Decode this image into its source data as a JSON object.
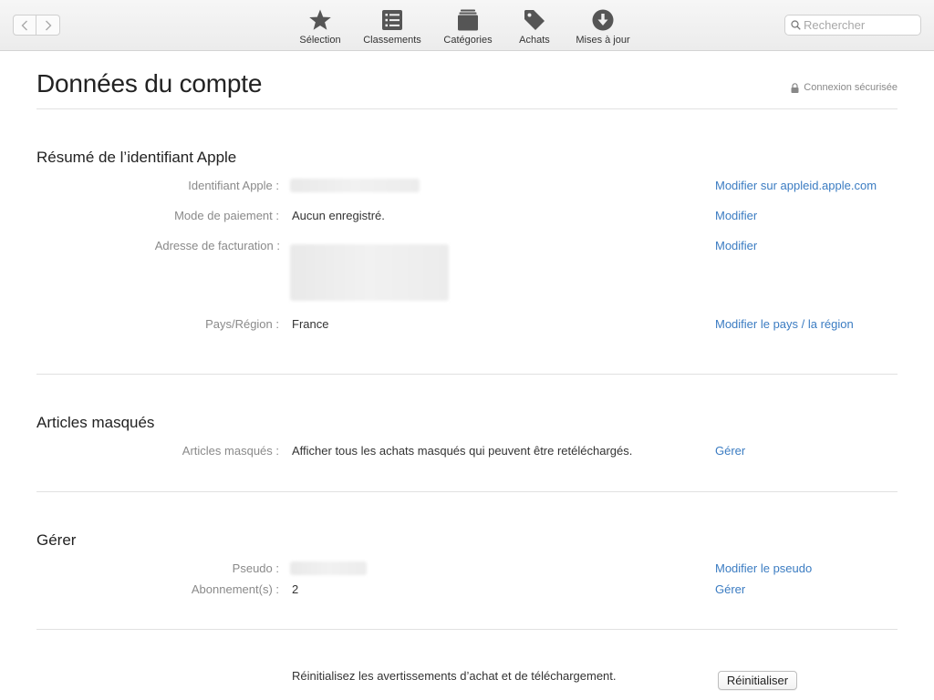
{
  "toolbar": {
    "items": [
      {
        "label": "Sélection",
        "icon": "star-icon"
      },
      {
        "label": "Classements",
        "icon": "list-icon"
      },
      {
        "label": "Catégories",
        "icon": "stack-icon"
      },
      {
        "label": "Achats",
        "icon": "tag-icon"
      },
      {
        "label": "Mises à jour",
        "icon": "download-icon"
      }
    ],
    "search_placeholder": "Rechercher"
  },
  "header": {
    "title": "Données du compte",
    "secure_label": "Connexion sécurisée"
  },
  "summary": {
    "title": "Résumé de l’identifiant Apple",
    "apple_id_label": "Identifiant Apple :",
    "apple_id_link": "Modifier sur appleid.apple.com",
    "payment_label": "Mode de paiement :",
    "payment_value": "Aucun enregistré.",
    "payment_link": "Modifier",
    "billing_label": "Adresse de facturation  :",
    "billing_link": "Modifier",
    "country_label": "Pays/Région :",
    "country_value": "France",
    "country_link": "Modifier le pays / la région"
  },
  "hidden": {
    "title": "Articles masqués",
    "label": "Articles masqués :",
    "value": "Afficher tous les achats masqués qui peuvent être retéléchargés.",
    "link": "Gérer"
  },
  "manage": {
    "title": "Gérer",
    "nickname_label": "Pseudo :",
    "nickname_link": "Modifier le pseudo",
    "subs_label": "Abonnement(s) :",
    "subs_value": "2",
    "subs_link": "Gérer"
  },
  "reset": {
    "text": "Réinitialisez les avertissements d’achat et de téléchargement.",
    "button": "Réinitialiser"
  },
  "colors": {
    "link": "#3b7cc2",
    "label": "#8a8a8a"
  }
}
